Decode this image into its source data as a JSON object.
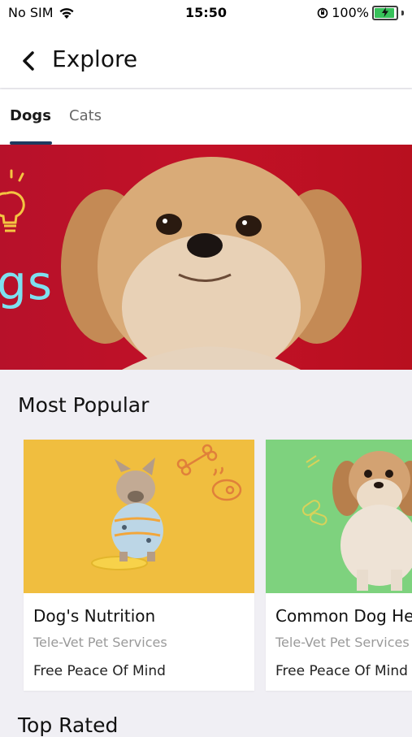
{
  "status_bar": {
    "carrier": "No SIM",
    "time": "15:50",
    "battery_percent": "100%",
    "battery_level": 1.0,
    "charging": true
  },
  "nav": {
    "title": "Explore",
    "back_icon": "chevron-left-icon"
  },
  "tabs": [
    {
      "label": "Dogs",
      "selected": true
    },
    {
      "label": "Cats",
      "selected": false
    }
  ],
  "banner": {
    "text": "gs",
    "background_color": "#c21127",
    "accent_color": "#7ee1f0"
  },
  "sections": {
    "most_popular": {
      "title": "Most Popular",
      "cards": [
        {
          "title": "Dog's Nutrition",
          "provider": "Tele-Vet Pet Services",
          "detail": "Free Peace Of Mind",
          "image_bg": "#f0be3f"
        },
        {
          "title": "Common Dog He",
          "provider": "Tele-Vet Pet Services",
          "detail": "Free Peace Of Mind",
          "image_bg": "#7ed27e"
        }
      ]
    },
    "top_rated": {
      "title": "Top Rated"
    }
  },
  "colors": {
    "tab_indicator": "#1f3a5f",
    "page_background": "#f0eff4"
  }
}
